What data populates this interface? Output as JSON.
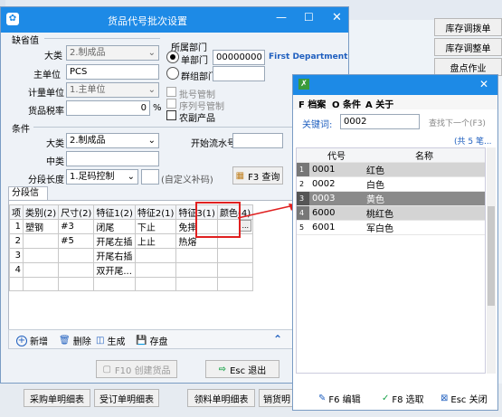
{
  "bg_window": {
    "right_buttons": [
      "库存调拨单",
      "库存调整单",
      "盘点作业"
    ],
    "bottom_buttons": [
      "采购单明细表",
      "受订单明细表",
      "领料单明细表",
      "销货明"
    ]
  },
  "dialog": {
    "title": "货品代号批次设置",
    "defaults_section": "缺省值",
    "category_label": "大类",
    "category_value": "2.制成品",
    "main_unit_label": "主单位",
    "main_unit_value": "PCS",
    "calc_unit_label": "计量单位",
    "calc_unit_value": "1.主单位",
    "tax_label": "货品税率",
    "tax_value": "0",
    "tax_unit": "%",
    "dept_group_title": "所属部门",
    "dept_single": "单部门",
    "dept_code": "00000000",
    "dept_name": "First Department",
    "dept_group": "群组部门",
    "chk_batch": "批号管制",
    "chk_serial": "序列号管制",
    "chk_agri": "农副产品",
    "conditions_section": "条件",
    "cond_category_label": "大类",
    "cond_category_value": "2.制成品",
    "mid_category_label": "中类",
    "seg_len_label": "分段长度",
    "seg_len_value": "1.足码控制",
    "custom_code": "(自定义补码)",
    "start_serial_label": "开始流水号",
    "query_btn": "F3 查询",
    "seg_tab": "分段信息",
    "grid_headers": [
      "项",
      "类别(2)",
      "尺寸(2)",
      "特征1(2)",
      "特征2(1)",
      "特征3(1)",
      "颜色(4)"
    ],
    "grid_rows": [
      [
        "1",
        "塑钢",
        "#3",
        "闭尾",
        "下止",
        "免摔",
        ""
      ],
      [
        "2",
        "",
        "#5",
        "开尾左插",
        "上止",
        "热熔",
        ""
      ],
      [
        "3",
        "",
        "",
        "开尾右插",
        "",
        "",
        ""
      ],
      [
        "4",
        "",
        "",
        "双开尾...",
        "",
        "",
        ""
      ]
    ],
    "ellipsis": "...",
    "tool_add": "新增",
    "tool_delete": "删除",
    "tool_generate": "生成",
    "tool_save": "存盘",
    "f10_btn": "F10 创建货品",
    "esc_btn": "Esc 退出"
  },
  "popup": {
    "menu_file": "F 档案",
    "menu_cond": "O 条件",
    "menu_about": "A 关于",
    "keyword_label": "关键词:",
    "keyword_value": "0002",
    "find_next": "查找下一个(F3)",
    "total": "(共 5 笔...",
    "col_code": "代号",
    "col_name": "名称",
    "rows": [
      {
        "idx": "1",
        "code": "0001",
        "name": "红色"
      },
      {
        "idx": "2",
        "code": "0002",
        "name": "白色"
      },
      {
        "idx": "3",
        "code": "0003",
        "name": "黄色"
      },
      {
        "idx": "4",
        "code": "6000",
        "name": "桃红色"
      },
      {
        "idx": "5",
        "code": "6001",
        "name": "军白色"
      }
    ],
    "btn_edit": "F6 编辑",
    "btn_select": "F8 选取",
    "btn_close": "Esc 关闭"
  },
  "colors": {
    "title_blue": "#1d8ae6",
    "highlight_red": "#e02020",
    "accent_blue": "#1f5fbf"
  }
}
